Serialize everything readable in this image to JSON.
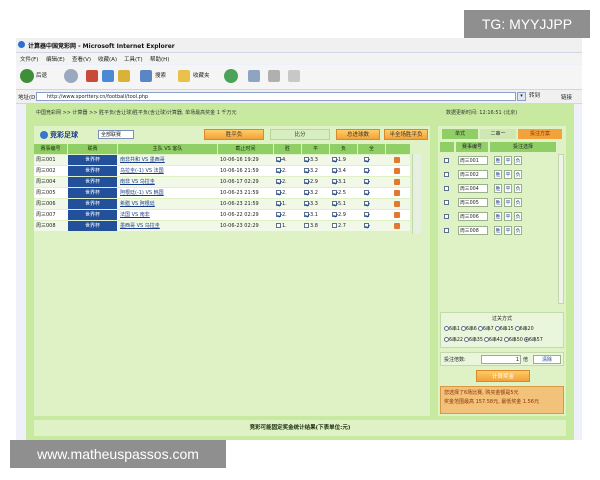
{
  "watermarks": {
    "top": "TG: MYYJJPP",
    "bottom": "www.matheuspassos.com"
  },
  "window": {
    "title": "计算器中国竞彩网 - Microsoft Internet Explorer"
  },
  "menu": [
    "文件(F)",
    "编辑(E)",
    "查看(V)",
    "收藏(A)",
    "工具(T)",
    "帮助(H)"
  ],
  "toolbar": {
    "back": "后退",
    "search": "搜索",
    "favorites": "收藏夹"
  },
  "address": {
    "label": "地址(D)",
    "url": "http://www.sporttery.cn/football/tool.php",
    "go": "转到",
    "links": "链接"
  },
  "breadcrumb": "中国竞彩网 >> 计算器 >> 胜平负(含让球)胜平负(含让球)计算器, 单场最高奖金 1 千万元",
  "timestamp": "数据更新时间: 12:16:51 (北京)",
  "left": {
    "logo": "竞彩足球",
    "league_select": "全部联赛",
    "buttons": {
      "select_all": "胜平负",
      "compare": "比分",
      "half": "总进球数",
      "half_full": "半全场胜平负"
    },
    "headers": [
      "赛事编号",
      "联赛",
      "主队 VS 客队",
      "截止时间",
      "胜",
      "平",
      "负",
      "全",
      ""
    ],
    "rows": [
      {
        "id": "周三001",
        "league": "世界杯",
        "match": "南非共和 VS 墨西哥",
        "time": "10-06-16 19:29",
        "w": "4.",
        "d": "3.3",
        "l": "1.9",
        "c": [
          true,
          true,
          true,
          true
        ]
      },
      {
        "id": "周三002",
        "league": "世界杯",
        "match": "乌拉圭(-1) VS 法国",
        "time": "10-06-16 21:59",
        "w": "2.",
        "d": "3.2",
        "l": "3.4",
        "c": [
          true,
          true,
          true,
          true
        ]
      },
      {
        "id": "周三004",
        "league": "世界杯",
        "match": "南非 VS 乌拉圭",
        "time": "10-06-17 02:29",
        "w": "2.",
        "d": "2.9",
        "l": "3.1",
        "c": [
          true,
          true,
          true,
          true
        ]
      },
      {
        "id": "周三005",
        "league": "世界杯",
        "match": "阿根廷(-1) VS 韩国",
        "time": "10-06-23 21:59",
        "w": "2.",
        "d": "3.2",
        "l": "2.5",
        "c": [
          true,
          true,
          true,
          true
        ]
      },
      {
        "id": "周三006",
        "league": "世界杯",
        "match": "希腊 VS 阿根廷",
        "time": "10-06-23 21:59",
        "w": "1.",
        "d": "3.3",
        "l": "5.1",
        "c": [
          true,
          true,
          true,
          true
        ]
      },
      {
        "id": "周三007",
        "league": "世界杯",
        "match": "法国 VS 南非",
        "time": "10-06-22 02:29",
        "w": "2.",
        "d": "3.1",
        "l": "2.9",
        "c": [
          true,
          true,
          true,
          true
        ]
      },
      {
        "id": "周三008",
        "league": "世界杯",
        "match": "墨西哥 VS 乌拉圭",
        "time": "10-06-23 02:29",
        "w": "1.",
        "d": "3.8",
        "l": "2.7",
        "c": [
          false,
          false,
          false,
          true
        ]
      }
    ]
  },
  "right": {
    "tabs": [
      "单式",
      "二串一",
      "投注方案"
    ],
    "headers": [
      "",
      "赛事编号",
      "投注选择"
    ],
    "rows": [
      {
        "id": "周三001",
        "picks": [
          "胜",
          "平",
          "负"
        ]
      },
      {
        "id": "周三002",
        "picks": [
          "胜",
          "平",
          "负"
        ]
      },
      {
        "id": "周三004",
        "picks": [
          "胜",
          "平",
          "负"
        ]
      },
      {
        "id": "周三005",
        "picks": [
          "胜",
          "平",
          "负"
        ]
      },
      {
        "id": "周三006",
        "picks": [
          "胜",
          "平",
          "负"
        ]
      },
      {
        "id": "周三008",
        "picks": [
          "胜",
          "平",
          "负"
        ]
      }
    ],
    "pass_label": "过关方式",
    "pass_options_row1": [
      "6串1",
      "6串6",
      "6串7",
      "6串15",
      "6串20"
    ],
    "pass_options_row2": [
      "6串22",
      "6串35",
      "6串42",
      "6串50",
      "6串57"
    ],
    "multiplier_label": "投注倍数:",
    "multiplier_value": "1",
    "multiplier_suffix": "倍",
    "calc_btn": "计算奖金",
    "clear_btn": "清除",
    "info_line1": "您选择了6场比赛, 购买金额是5元",
    "info_line2": "奖金范围最高 157.58元, 最低奖金 1.56元"
  },
  "bottom_text": "竞彩可能固定奖金统计结果(下表单位:元)"
}
